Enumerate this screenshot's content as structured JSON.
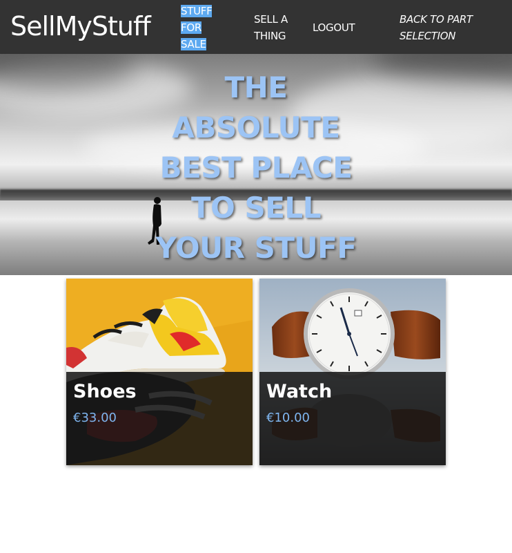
{
  "header": {
    "brand": "SellMyStuff",
    "nav": {
      "stuff_for_sale": [
        "STUFF",
        "FOR",
        "SALE"
      ],
      "sell_a_thing": "SELL A THING",
      "logout": "LOGOUT",
      "back": "BACK TO PART SELECTION"
    }
  },
  "hero": {
    "title_lines": [
      "THE",
      "ABSOLUTE",
      "BEST PLACE",
      "TO SELL",
      "YOUR STUFF"
    ]
  },
  "items": [
    {
      "name": "Shoes",
      "price": "€33.00",
      "image": "sneaker-photo"
    },
    {
      "name": "Watch",
      "price": "€10.00",
      "image": "wristwatch-photo"
    }
  ],
  "colors": {
    "navbar": "#333333",
    "accent": "#5da9f0",
    "hero_title": "#9cc4f5",
    "price": "#7fb6f0"
  }
}
